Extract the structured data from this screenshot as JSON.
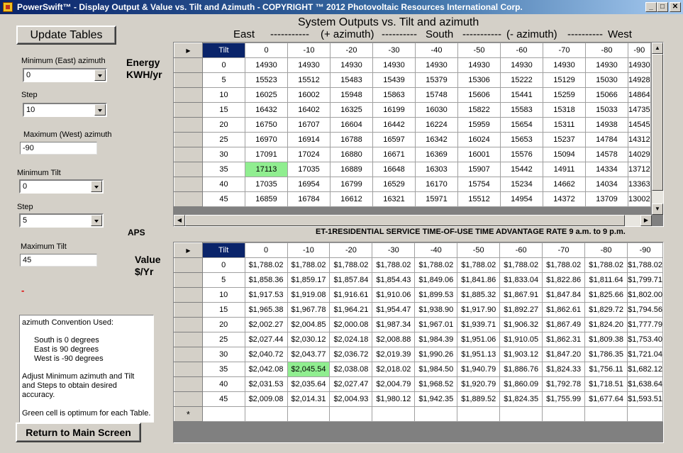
{
  "window": {
    "title": "PowerSwift™ - Display Output & Value vs. Tilt and Azimuth -  COPYRIGHT ™ 2012 Photovoltaic Resources International Corp.",
    "min_glyph": "_",
    "max_glyph": "□",
    "close_glyph": "✕"
  },
  "buttons": {
    "update_tables": "Update Tables",
    "return_main": "Return to Main Screen"
  },
  "controls": {
    "min_azimuth_label": "Minimum (East) azimuth",
    "min_azimuth_value": "0",
    "azimuth_step_label": "Step",
    "azimuth_step_value": "10",
    "max_azimuth_label": "Maximum (West) azimuth",
    "max_azimuth_value": "-90",
    "min_tilt_label": "Minimum Tilt",
    "min_tilt_value": "0",
    "tilt_step_label": "Step",
    "tilt_step_value": "5",
    "max_tilt_label": "Maximum Tilt",
    "max_tilt_value": "45",
    "red_mark": "-"
  },
  "header": {
    "title": "System Outputs vs. Tilt and azimuth",
    "east": "East",
    "dash1": "-----------",
    "plus_azimuth": "(+ azimuth)",
    "dash2": "----------",
    "south": "South",
    "dash3": "-----------",
    "minus_azimuth": "(- azimuth)",
    "dash4": "----------",
    "west": "West"
  },
  "energy_table": {
    "label_line1": "Energy",
    "label_line2": "KWH/yr",
    "columns": [
      "Tilt",
      "0",
      "-10",
      "-20",
      "-30",
      "-40",
      "-50",
      "-60",
      "-70",
      "-80",
      "-90"
    ],
    "rows": [
      [
        "0",
        "14930",
        "14930",
        "14930",
        "14930",
        "14930",
        "14930",
        "14930",
        "14930",
        "14930",
        "14930"
      ],
      [
        "5",
        "15523",
        "15512",
        "15483",
        "15439",
        "15379",
        "15306",
        "15222",
        "15129",
        "15030",
        "14928"
      ],
      [
        "10",
        "16025",
        "16002",
        "15948",
        "15863",
        "15748",
        "15606",
        "15441",
        "15259",
        "15066",
        "14864"
      ],
      [
        "15",
        "16432",
        "16402",
        "16325",
        "16199",
        "16030",
        "15822",
        "15583",
        "15318",
        "15033",
        "14735"
      ],
      [
        "20",
        "16750",
        "16707",
        "16604",
        "16442",
        "16224",
        "15959",
        "15654",
        "15311",
        "14938",
        "14545"
      ],
      [
        "25",
        "16970",
        "16914",
        "16788",
        "16597",
        "16342",
        "16024",
        "15653",
        "15237",
        "14784",
        "14312"
      ],
      [
        "30",
        "17091",
        "17024",
        "16880",
        "16671",
        "16369",
        "16001",
        "15576",
        "15094",
        "14578",
        "14029"
      ],
      [
        "35",
        "17113",
        "17035",
        "16889",
        "16648",
        "16303",
        "15907",
        "15442",
        "14911",
        "14334",
        "13712"
      ],
      [
        "40",
        "17035",
        "16954",
        "16799",
        "16529",
        "16170",
        "15754",
        "15234",
        "14662",
        "14034",
        "13363"
      ],
      [
        "45",
        "16859",
        "16784",
        "16612",
        "16321",
        "15971",
        "15512",
        "14954",
        "14372",
        "13709",
        "13002"
      ]
    ]
  },
  "rate": {
    "utility": "APS",
    "description": "ET-1RESIDENTIAL SERVICE TIME-OF-USE TIME ADVANTAGE RATE 9 a.m. to 9 p.m."
  },
  "value_table": {
    "label_line1": "Value",
    "label_line2": "$/Yr",
    "columns": [
      "Tilt",
      "0",
      "-10",
      "-20",
      "-30",
      "-40",
      "-50",
      "-60",
      "-70",
      "-80",
      "-90"
    ],
    "rows": [
      [
        "0",
        "$1,788.02",
        "$1,788.02",
        "$1,788.02",
        "$1,788.02",
        "$1,788.02",
        "$1,788.02",
        "$1,788.02",
        "$1,788.02",
        "$1,788.02",
        "$1,788.02"
      ],
      [
        "5",
        "$1,858.36",
        "$1,859.17",
        "$1,857.84",
        "$1,854.43",
        "$1,849.06",
        "$1,841.86",
        "$1,833.04",
        "$1,822.86",
        "$1,811.64",
        "$1,799.71"
      ],
      [
        "10",
        "$1,917.53",
        "$1,919.08",
        "$1,916.61",
        "$1,910.06",
        "$1,899.53",
        "$1,885.32",
        "$1,867.91",
        "$1,847.84",
        "$1,825.66",
        "$1,802.00"
      ],
      [
        "15",
        "$1,965.38",
        "$1,967.78",
        "$1,964.21",
        "$1,954.47",
        "$1,938.90",
        "$1,917.90",
        "$1,892.27",
        "$1,862.61",
        "$1,829.72",
        "$1,794.56"
      ],
      [
        "20",
        "$2,002.27",
        "$2,004.85",
        "$2,000.08",
        "$1,987.34",
        "$1,967.01",
        "$1,939.71",
        "$1,906.32",
        "$1,867.49",
        "$1,824.20",
        "$1,777.79"
      ],
      [
        "25",
        "$2,027.44",
        "$2,030.12",
        "$2,024.18",
        "$2,008.88",
        "$1,984.39",
        "$1,951.06",
        "$1,910.05",
        "$1,862.31",
        "$1,809.38",
        "$1,753.40"
      ],
      [
        "30",
        "$2,040.72",
        "$2,043.77",
        "$2,036.72",
        "$2,019.39",
        "$1,990.26",
        "$1,951.13",
        "$1,903.12",
        "$1,847.20",
        "$1,786.35",
        "$1,721.04"
      ],
      [
        "35",
        "$2,042.08",
        "$2,045.54",
        "$2,038.08",
        "$2,018.02",
        "$1,984.50",
        "$1,940.79",
        "$1,886.76",
        "$1,824.33",
        "$1,756.11",
        "$1,682.12"
      ],
      [
        "40",
        "$2,031.53",
        "$2,035.64",
        "$2,027.47",
        "$2,004.79",
        "$1,968.52",
        "$1,920.79",
        "$1,860.09",
        "$1,792.78",
        "$1,718.51",
        "$1,638.64"
      ],
      [
        "45",
        "$2,009.08",
        "$2,014.31",
        "$2,004.93",
        "$1,980.12",
        "$1,942.35",
        "$1,889.52",
        "$1,824.35",
        "$1,755.99",
        "$1,677.64",
        "$1,593.51"
      ]
    ]
  },
  "highlights": {
    "energy_optimum": {
      "row": 7,
      "col": 1
    },
    "value_optimum": {
      "row": 7,
      "col": 2
    },
    "color": "#90ee90"
  },
  "info": {
    "line1": "azimuth Convention Used:",
    "line2": "South is 0 degrees",
    "line3": "East is 90 degrees",
    "line4": "West is -90 degrees",
    "line5": "Adjust Minimum azimuth and Tilt",
    "line6": "and Steps to obtain desired",
    "line7": "accuracy.",
    "line8": "Green cell is optimum for each Table."
  }
}
